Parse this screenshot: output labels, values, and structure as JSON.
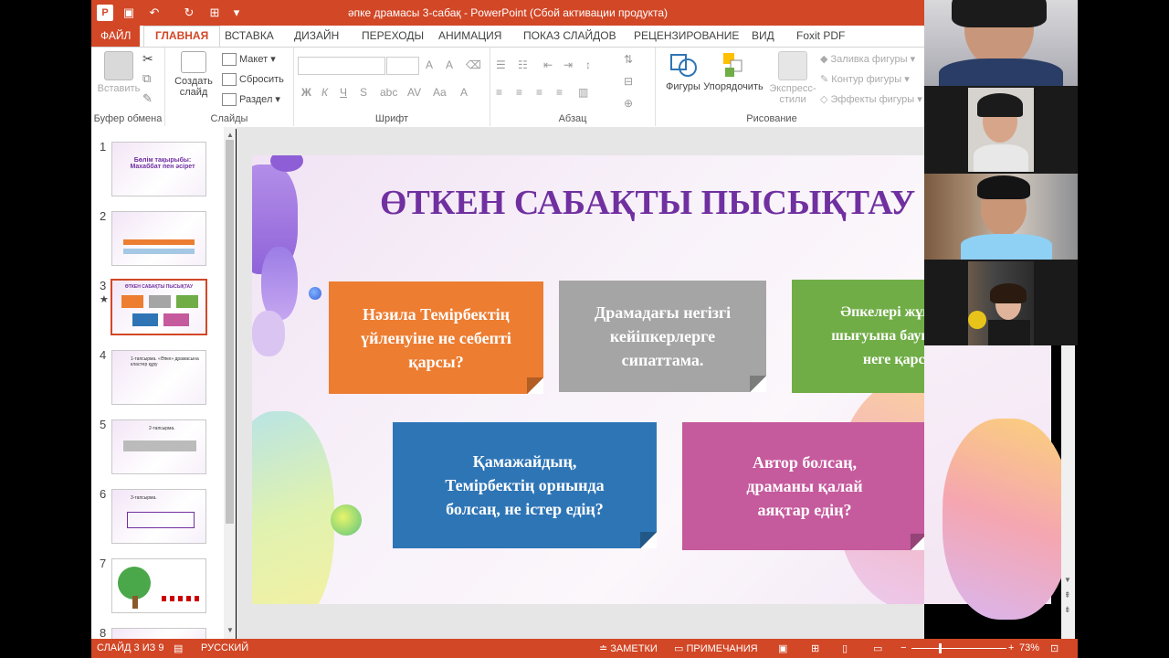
{
  "window": {
    "title": "әпке драмасы 3-сабақ -  PowerPoint (Сбой активации продукта)"
  },
  "tabs": [
    "ФАЙЛ",
    "ГЛАВНАЯ",
    "ВСТАВКА",
    "ДИЗАЙН",
    "ПЕРЕХОДЫ",
    "АНИМАЦИЯ",
    "ПОКАЗ СЛАЙДОВ",
    "РЕЦЕНЗИРОВАНИЕ",
    "ВИД",
    "Foxit PDF"
  ],
  "ribbon": {
    "paste": "Вставить",
    "clipboard_group": "Буфер обмена",
    "new_slide_line1": "Создать",
    "new_slide_line2": "слайд",
    "layout": "Макет",
    "reset": "Сбросить",
    "section": "Раздел",
    "slides_group": "Слайды",
    "font_group": "Шрифт",
    "bold": "Ж",
    "italic": "К",
    "underline": "Ч",
    "strike": "S",
    "paragraph_group": "Абзац",
    "shapes": "Фигуры",
    "arrange": "Упорядочить",
    "quick_styles_line1": "Экспресс-",
    "quick_styles_line2": "стили",
    "shape_fill": "Заливка фигуры",
    "shape_outline": "Контур фигуры",
    "shape_effects": "Эффекты фигуры",
    "drawing_group": "Рисование"
  },
  "thumbnails": [
    {
      "num": "1",
      "text": "Бөлім тақырыбы: Махаббат пен әсірет"
    },
    {
      "num": "2",
      "text": ""
    },
    {
      "num": "3",
      "text": "ӨТКЕН САБАҚТЫ ПЫСЫҚТАУ",
      "star": "★"
    },
    {
      "num": "4",
      "text": "1-тапсырма. «Әпке» драмасына кластер құру"
    },
    {
      "num": "5",
      "text": "2-тапсырма."
    },
    {
      "num": "6",
      "text": "3-тапсырма."
    },
    {
      "num": "7",
      "text": ""
    },
    {
      "num": "8",
      "text": ""
    }
  ],
  "slide": {
    "title": "ӨТКЕН САБАҚТЫ ПЫСЫҚТАУ",
    "cards": [
      {
        "text": "Нәзила Темірбектің үйленуіне не себепті қарсы?",
        "color": "#ed7d31"
      },
      {
        "text": "Драмадағы негізгі кейіпкерлерге сипаттама.",
        "color": "#a5a5a5"
      },
      {
        "text": "Әпкелері жұмыска шығуына бауырлары неге қарсы?",
        "color": "#70ad47"
      },
      {
        "text": "Қамажайдың, Темірбектің орнында болсаң, не істер едің?",
        "color": "#2e75b6"
      },
      {
        "text": "Автор болсаң, драманы қалай аяқтар едің?",
        "color": "#c55a9d"
      }
    ]
  },
  "status": {
    "slide_info": "СЛАЙД 3 ИЗ 9",
    "language": "РУССКИЙ",
    "notes": "ЗАМЕТКИ",
    "comments": "ПРИМЕЧАНИЯ",
    "zoom": "73%"
  },
  "colors": {
    "accent": "#d24726",
    "title": "#7030a0"
  }
}
